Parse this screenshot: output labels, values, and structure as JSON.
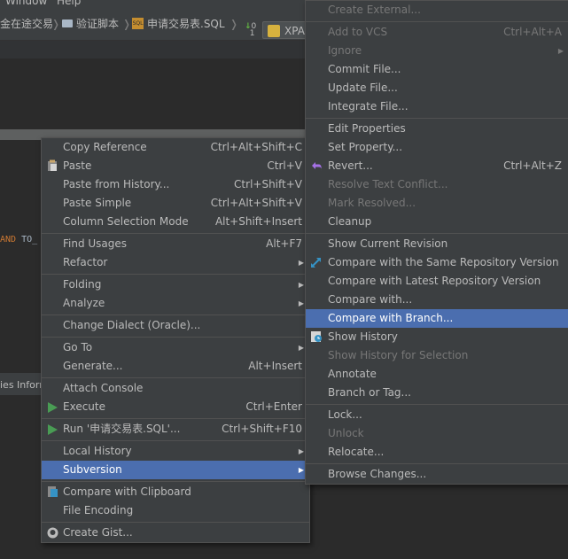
{
  "menubar": {
    "window": "Window",
    "help": "Help"
  },
  "breadcrumbs": [
    {
      "label": "金在途交易",
      "icon": "none"
    },
    {
      "label": "验证脚本",
      "icon": "folder-icon"
    },
    {
      "label": "申请交易表.SQL",
      "icon": "sql-file-icon"
    }
  ],
  "toolbar": {
    "xpath_label": "XPA"
  },
  "editor": {
    "code_keyword": "AND",
    "code_text": "TO_"
  },
  "statusbar": {
    "text": "ies Inform"
  },
  "context_menu": {
    "items": [
      {
        "label": "Copy Reference",
        "shortcut": "Ctrl+Alt+Shift+C"
      },
      {
        "label": "Paste",
        "shortcut": "Ctrl+V",
        "icon": "paste-icon"
      },
      {
        "label": "Paste from History...",
        "shortcut": "Ctrl+Shift+V"
      },
      {
        "label": "Paste Simple",
        "shortcut": "Ctrl+Alt+Shift+V"
      },
      {
        "label": "Column Selection Mode",
        "shortcut": "Alt+Shift+Insert"
      },
      {
        "sep": true
      },
      {
        "label": "Find Usages",
        "shortcut": "Alt+F7"
      },
      {
        "label": "Refactor",
        "submenu": true
      },
      {
        "sep": true
      },
      {
        "label": "Folding",
        "submenu": true
      },
      {
        "label": "Analyze",
        "submenu": true
      },
      {
        "sep": true
      },
      {
        "label": "Change Dialect (Oracle)..."
      },
      {
        "sep": true
      },
      {
        "label": "Go To",
        "submenu": true
      },
      {
        "label": "Generate...",
        "shortcut": "Alt+Insert"
      },
      {
        "sep": true
      },
      {
        "label": "Attach Console"
      },
      {
        "label": "Execute",
        "shortcut": "Ctrl+Enter",
        "icon": "run-icon"
      },
      {
        "sep": true
      },
      {
        "label": "Run '申请交易表.SQL'...",
        "shortcut": "Ctrl+Shift+F10",
        "icon": "run-icon"
      },
      {
        "sep": true
      },
      {
        "label": "Local History",
        "submenu": true
      },
      {
        "label": "Subversion",
        "submenu": true,
        "selected": true
      },
      {
        "sep": true
      },
      {
        "label": "Compare with Clipboard",
        "icon": "compare-clipboard-icon"
      },
      {
        "label": "File Encoding"
      },
      {
        "sep": true
      },
      {
        "label": "Create Gist...",
        "icon": "github-icon"
      }
    ]
  },
  "subversion_menu": {
    "items": [
      {
        "label": "Create External...",
        "disabled": true
      },
      {
        "sep": true
      },
      {
        "label": "Add to VCS",
        "shortcut": "Ctrl+Alt+A",
        "disabled": true
      },
      {
        "label": "Ignore",
        "submenu": true,
        "disabled": true
      },
      {
        "label": "Commit File..."
      },
      {
        "label": "Update File..."
      },
      {
        "label": "Integrate File..."
      },
      {
        "sep": true
      },
      {
        "label": "Edit Properties"
      },
      {
        "label": "Set Property..."
      },
      {
        "label": "Revert...",
        "shortcut": "Ctrl+Alt+Z",
        "icon": "revert-icon"
      },
      {
        "label": "Resolve Text Conflict...",
        "disabled": true
      },
      {
        "label": "Mark Resolved...",
        "disabled": true
      },
      {
        "label": "Cleanup"
      },
      {
        "sep": true
      },
      {
        "label": "Show Current Revision"
      },
      {
        "label": "Compare with the Same Repository Version",
        "icon": "compare-arrows-icon"
      },
      {
        "label": "Compare with Latest Repository Version"
      },
      {
        "label": "Compare with..."
      },
      {
        "label": "Compare with Branch...",
        "selected": true
      },
      {
        "label": "Show History",
        "icon": "history-icon"
      },
      {
        "label": "Show History for Selection",
        "disabled": true
      },
      {
        "label": "Annotate"
      },
      {
        "label": "Branch or Tag..."
      },
      {
        "sep": true
      },
      {
        "label": "Lock..."
      },
      {
        "label": "Unlock",
        "disabled": true
      },
      {
        "label": "Relocate..."
      },
      {
        "sep": true
      },
      {
        "label": "Browse Changes..."
      }
    ]
  },
  "colors": {
    "menu_bg": "#3c3f41",
    "selection": "#4b6eaf",
    "text": "#bbbbbb",
    "disabled_text": "#777777",
    "run_green": "#499c54",
    "revert_purple": "#a571e6",
    "compare_blue": "#3592c4"
  }
}
